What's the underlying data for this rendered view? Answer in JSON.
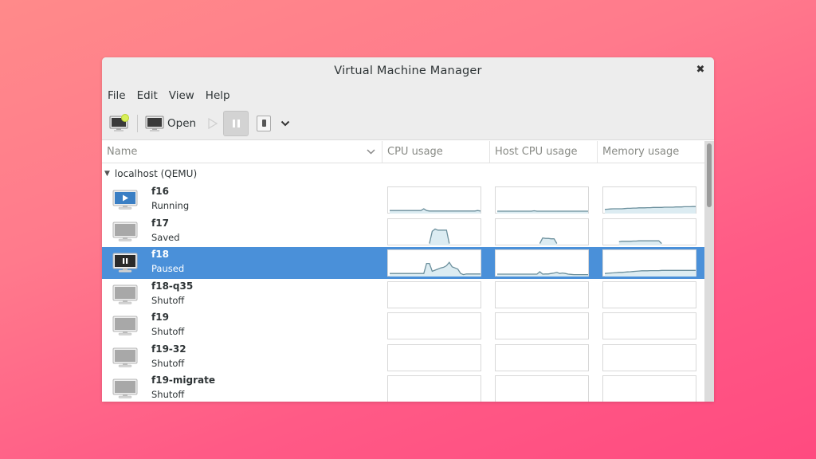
{
  "window": {
    "title": "Virtual Machine Manager"
  },
  "menubar": {
    "items": [
      "File",
      "Edit",
      "View",
      "Help"
    ]
  },
  "toolbar": {
    "new_vm_icon": "new-vm-icon",
    "open_label": "Open",
    "run_icon": "play-icon",
    "pause_icon": "pause-icon",
    "shutdown_icon": "shutdown-icon",
    "more_icon": "chevron-down-icon"
  },
  "list": {
    "columns": [
      "Name",
      "CPU usage",
      "Host CPU usage",
      "Memory usage"
    ],
    "group": "localhost (QEMU)",
    "vms": [
      {
        "name": "f16",
        "status": "Running",
        "state": "running",
        "selected": false,
        "cpu": [
          0.1,
          0.1,
          0.1,
          0.1,
          0.1,
          0.1,
          0.1,
          0.1,
          0.1,
          0.1,
          0.1,
          0.1,
          0.18,
          0.1,
          0.08,
          0.08,
          0.08,
          0.08,
          0.08,
          0.08,
          0.08,
          0.08,
          0.08,
          0.08,
          0.08,
          0.08,
          0.08,
          0.08,
          0.08,
          0.08,
          0.08,
          0.1,
          0.08
        ],
        "host_cpu": [
          0.07,
          0.07,
          0.07,
          0.07,
          0.07,
          0.07,
          0.07,
          0.07,
          0.07,
          0.07,
          0.07,
          0.07,
          0.07,
          0.09,
          0.07,
          0.07,
          0.07,
          0.07,
          0.07,
          0.07,
          0.07,
          0.07,
          0.07,
          0.07,
          0.07,
          0.07,
          0.07,
          0.07,
          0.07,
          0.07,
          0.07,
          0.07,
          0.07
        ],
        "memory": [
          0.15,
          0.16,
          0.17,
          0.18,
          0.18,
          0.18,
          0.18,
          0.19,
          0.2,
          0.2,
          0.21,
          0.21,
          0.22,
          0.22,
          0.22,
          0.23,
          0.23,
          0.24,
          0.24,
          0.24,
          0.24,
          0.25,
          0.25,
          0.25,
          0.25,
          0.26,
          0.26,
          0.26,
          0.27,
          0.27,
          0.27,
          0.28,
          0.28
        ]
      },
      {
        "name": "f17",
        "status": "Saved",
        "state": "saved",
        "selected": false,
        "cpu": [
          null,
          null,
          null,
          null,
          null,
          null,
          null,
          null,
          null,
          null,
          null,
          null,
          null,
          null,
          0.05,
          0.6,
          0.7,
          0.65,
          0.65,
          0.65,
          0.65,
          0.05,
          null,
          null,
          null,
          null,
          null,
          null,
          null,
          null,
          null,
          null,
          null
        ],
        "host_cpu": [
          null,
          null,
          null,
          null,
          null,
          null,
          null,
          null,
          null,
          null,
          null,
          null,
          null,
          null,
          null,
          0.05,
          0.3,
          0.28,
          0.28,
          0.26,
          0.26,
          0.05,
          null,
          null,
          null,
          null,
          null,
          null,
          null,
          null,
          null,
          null,
          null
        ],
        "memory": [
          null,
          null,
          null,
          null,
          null,
          0.13,
          0.15,
          0.15,
          0.15,
          0.15,
          0.16,
          0.16,
          0.17,
          0.17,
          0.17,
          0.17,
          0.17,
          0.17,
          0.17,
          0.17,
          0.05,
          null,
          null,
          null,
          null,
          null,
          null,
          null,
          null,
          null,
          null,
          null,
          null
        ]
      },
      {
        "name": "f18",
        "status": "Paused",
        "state": "paused",
        "selected": true,
        "cpu": [
          0.1,
          0.1,
          0.1,
          0.1,
          0.1,
          0.1,
          0.1,
          0.1,
          0.1,
          0.1,
          0.1,
          0.1,
          0.1,
          0.55,
          0.55,
          0.2,
          0.25,
          0.3,
          0.35,
          0.38,
          0.45,
          0.6,
          0.4,
          0.35,
          0.3,
          0.1,
          0.05,
          0.08,
          0.08,
          0.08,
          0.08,
          0.08,
          0.08
        ],
        "host_cpu": [
          0.07,
          0.07,
          0.07,
          0.07,
          0.07,
          0.07,
          0.07,
          0.07,
          0.07,
          0.07,
          0.07,
          0.07,
          0.07,
          0.07,
          0.07,
          0.18,
          0.07,
          0.08,
          0.08,
          0.1,
          0.12,
          0.15,
          0.1,
          0.12,
          0.1,
          0.07,
          0.06,
          0.05,
          0.05,
          0.05,
          0.05,
          0.05,
          0.05
        ],
        "memory": [
          0.1,
          0.11,
          0.12,
          0.13,
          0.14,
          0.15,
          0.15,
          0.16,
          0.17,
          0.18,
          0.19,
          0.2,
          0.21,
          0.22,
          0.22,
          0.22,
          0.23,
          0.23,
          0.23,
          0.23,
          0.24,
          0.24,
          0.24,
          0.24,
          0.24,
          0.24,
          0.24,
          0.24,
          0.24,
          0.24,
          0.24,
          0.24,
          0.24
        ]
      },
      {
        "name": "f18-q35",
        "status": "Shutoff",
        "state": "shutoff",
        "selected": false,
        "cpu": [],
        "host_cpu": [],
        "memory": []
      },
      {
        "name": "f19",
        "status": "Shutoff",
        "state": "shutoff",
        "selected": false,
        "cpu": [],
        "host_cpu": [],
        "memory": []
      },
      {
        "name": "f19-32",
        "status": "Shutoff",
        "state": "shutoff",
        "selected": false,
        "cpu": [],
        "host_cpu": [],
        "memory": []
      },
      {
        "name": "f19-migrate",
        "status": "Shutoff",
        "state": "shutoff",
        "selected": false,
        "cpu": [],
        "host_cpu": [],
        "memory": []
      }
    ]
  },
  "colors": {
    "selection": "#4a90d9",
    "graph_line": "#6b8f9c",
    "graph_fill": "#dcecf2"
  }
}
